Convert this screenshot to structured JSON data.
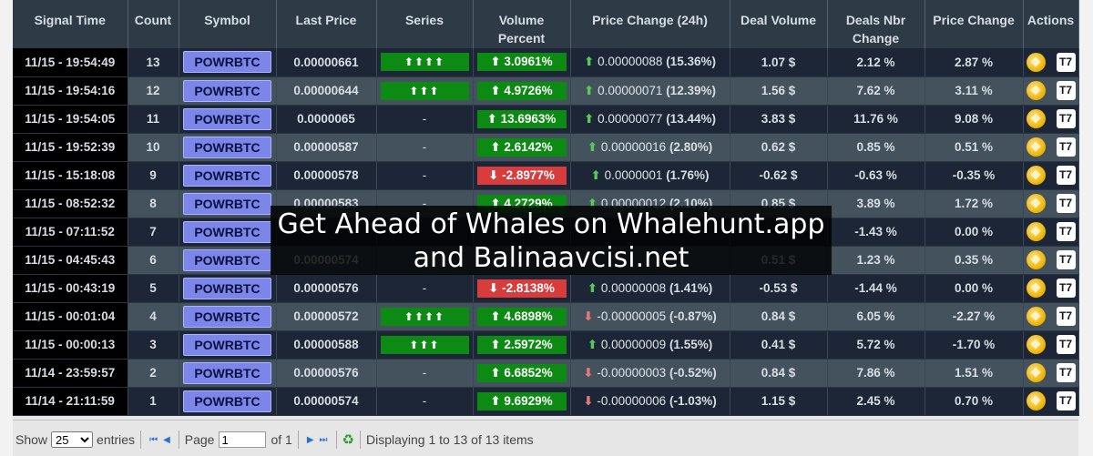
{
  "columns": [
    "Signal Time",
    "Count",
    "Symbol",
    "Last Price",
    "Series",
    "Volume\nPercent",
    "Price Change (24h)",
    "Deal Volume",
    "Deals Nbr\nChange",
    "Price Change",
    "Actions"
  ],
  "rows": [
    {
      "time": "11/15 - 19:54:49",
      "count": "13",
      "symbol": "POWRBTC",
      "last_price": "0.00000661",
      "price_dir": "up",
      "series": "⬆⬆⬆⬆",
      "vol_dir": "up",
      "vol": "⬆ 3.0961%",
      "pc_arrow": "⬆",
      "pc_dir": "up",
      "pc_value": "0.00000088",
      "pc_pct": "(15.36%)",
      "deal_volume": "1.07 $",
      "deals_nbr": "2.12 %",
      "price_change": "2.87 %"
    },
    {
      "time": "11/15 - 19:54:16",
      "count": "12",
      "symbol": "POWRBTC",
      "last_price": "0.00000644",
      "price_dir": "up",
      "series": "⬆⬆⬆",
      "vol_dir": "up",
      "vol": "⬆ 4.9726%",
      "pc_arrow": "⬆",
      "pc_dir": "up",
      "pc_value": "0.00000071",
      "pc_pct": "(12.39%)",
      "deal_volume": "1.56 $",
      "deals_nbr": "7.62 %",
      "price_change": "3.11 %"
    },
    {
      "time": "11/15 - 19:54:05",
      "count": "11",
      "symbol": "POWRBTC",
      "last_price": "0.0000065",
      "price_dir": "up",
      "series": "-",
      "vol_dir": "up",
      "vol": "⬆ 13.6963%",
      "pc_arrow": "⬆",
      "pc_dir": "up",
      "pc_value": "0.00000077",
      "pc_pct": "(13.44%)",
      "deal_volume": "3.83 $",
      "deals_nbr": "11.76 %",
      "price_change": "9.08 %"
    },
    {
      "time": "11/15 - 19:52:39",
      "count": "10",
      "symbol": "POWRBTC",
      "last_price": "0.00000587",
      "price_dir": "up",
      "series": "-",
      "vol_dir": "up",
      "vol": "⬆ 2.6142%",
      "pc_arrow": "⬆",
      "pc_dir": "up",
      "pc_value": "0.00000016",
      "pc_pct": "(2.80%)",
      "deal_volume": "0.62 $",
      "deals_nbr": "0.85 %",
      "price_change": "0.51 %"
    },
    {
      "time": "11/15 - 15:18:08",
      "count": "9",
      "symbol": "POWRBTC",
      "last_price": "0.00000578",
      "price_dir": "up",
      "series": "-",
      "vol_dir": "down",
      "vol": "⬇ -2.8977%",
      "pc_arrow": "⬆",
      "pc_dir": "up",
      "pc_value": "0.0000001",
      "pc_pct": "(1.76%)",
      "deal_volume": "-0.62 $",
      "deals_nbr": "-0.63 %",
      "price_change": "-0.35 %"
    },
    {
      "time": "11/15 - 08:52:32",
      "count": "8",
      "symbol": "POWRBTC",
      "last_price": "0.00000583",
      "price_dir": "up",
      "series": "-",
      "vol_dir": "up",
      "vol": "⬆ 4.2729%",
      "pc_arrow": "⬆",
      "pc_dir": "up",
      "pc_value": "0.00000012",
      "pc_pct": "(2.10%)",
      "deal_volume": "0.85 $",
      "deals_nbr": "3.89 %",
      "price_change": "1.72 %"
    },
    {
      "time": "11/15 - 07:11:52",
      "count": "7",
      "symbol": "POWRBTC",
      "last_price": "",
      "price_dir": "up",
      "series": "",
      "vol_dir": "none",
      "vol": "",
      "pc_arrow": "",
      "pc_dir": "up",
      "pc_value": "",
      "pc_pct": "",
      "deal_volume": "",
      "deals_nbr": "-1.43 %",
      "price_change": "0.00 %"
    },
    {
      "time": "11/15 - 04:45:43",
      "count": "6",
      "symbol": "POWRBTC",
      "last_price": "0.00000574",
      "price_dir": "down",
      "series": "",
      "vol_dir": "none",
      "vol": "",
      "pc_arrow": "",
      "pc_dir": "up",
      "pc_value": "",
      "pc_pct": "",
      "deal_volume": "0.51 $",
      "deals_nbr": "1.23 %",
      "price_change": "0.35 %"
    },
    {
      "time": "11/15 - 00:43:19",
      "count": "5",
      "symbol": "POWRBTC",
      "last_price": "0.00000576",
      "price_dir": "up",
      "series": "-",
      "vol_dir": "down",
      "vol": "⬇ -2.8138%",
      "pc_arrow": "⬆",
      "pc_dir": "up",
      "pc_value": "0.00000008",
      "pc_pct": "(1.41%)",
      "deal_volume": "-0.53 $",
      "deals_nbr": "-1.44 %",
      "price_change": "0.00 %"
    },
    {
      "time": "11/15 - 00:01:04",
      "count": "4",
      "symbol": "POWRBTC",
      "last_price": "0.00000572",
      "price_dir": "down",
      "series": "⬆⬆⬆⬆",
      "vol_dir": "up",
      "vol": "⬆ 4.6898%",
      "pc_arrow": "⬇",
      "pc_dir": "down",
      "pc_value": "-0.00000005",
      "pc_pct": "(-0.87%)",
      "deal_volume": "0.84 $",
      "deals_nbr": "6.05 %",
      "price_change": "-2.27 %"
    },
    {
      "time": "11/15 - 00:00:13",
      "count": "3",
      "symbol": "POWRBTC",
      "last_price": "0.00000588",
      "price_dir": "up",
      "series": "⬆⬆⬆",
      "vol_dir": "up",
      "vol": "⬆ 2.5972%",
      "pc_arrow": "⬆",
      "pc_dir": "up",
      "pc_value": "0.00000009",
      "pc_pct": "(1.55%)",
      "deal_volume": "0.41 $",
      "deals_nbr": "5.72 %",
      "price_change": "-1.70 %"
    },
    {
      "time": "11/14 - 23:59:57",
      "count": "2",
      "symbol": "POWRBTC",
      "last_price": "0.00000576",
      "price_dir": "up",
      "series": "-",
      "vol_dir": "up",
      "vol": "⬆ 6.6852%",
      "pc_arrow": "⬇",
      "pc_dir": "down",
      "pc_value": "-0.00000003",
      "pc_pct": "(-0.52%)",
      "deal_volume": "0.84 $",
      "deals_nbr": "7.86 %",
      "price_change": "1.51 %"
    },
    {
      "time": "11/14 - 21:11:59",
      "count": "1",
      "symbol": "POWRBTC",
      "last_price": "0.00000574",
      "price_dir": "up",
      "series": "-",
      "vol_dir": "up",
      "vol": "⬆ 9.6929%",
      "pc_arrow": "⬇",
      "pc_dir": "down",
      "pc_value": "-0.00000006",
      "pc_pct": "(-1.03%)",
      "deal_volume": "1.15 $",
      "deals_nbr": "2.45 %",
      "price_change": "0.70 %"
    }
  ],
  "icons": {
    "binance": "binance-coin-icon",
    "tradingview": "tradingview-icon",
    "tv_glyph": "T7"
  },
  "footer": {
    "show_label": "Show",
    "page_size": "25",
    "page_size_options": [
      "25"
    ],
    "entries_label": "entries",
    "page_label": "Page",
    "page_value": "1",
    "of_label": "of 1",
    "display_text": "Displaying 1 to 13 of 13 items",
    "first": "⏮",
    "prev": "◀",
    "next": "▶",
    "last": "⏭",
    "refresh": "♻"
  },
  "overlay": {
    "line1": "Get Ahead of Whales on Whalehunt.app",
    "line2": "and Balinaavcisi.net"
  },
  "colors": {
    "header_bg": "#2e3a45",
    "row_light": "#44525e",
    "row_dark": "#1c2636",
    "up_green": "#0d8a13",
    "down_red": "#d83c3c",
    "symbol_button": "#7b86e8"
  }
}
